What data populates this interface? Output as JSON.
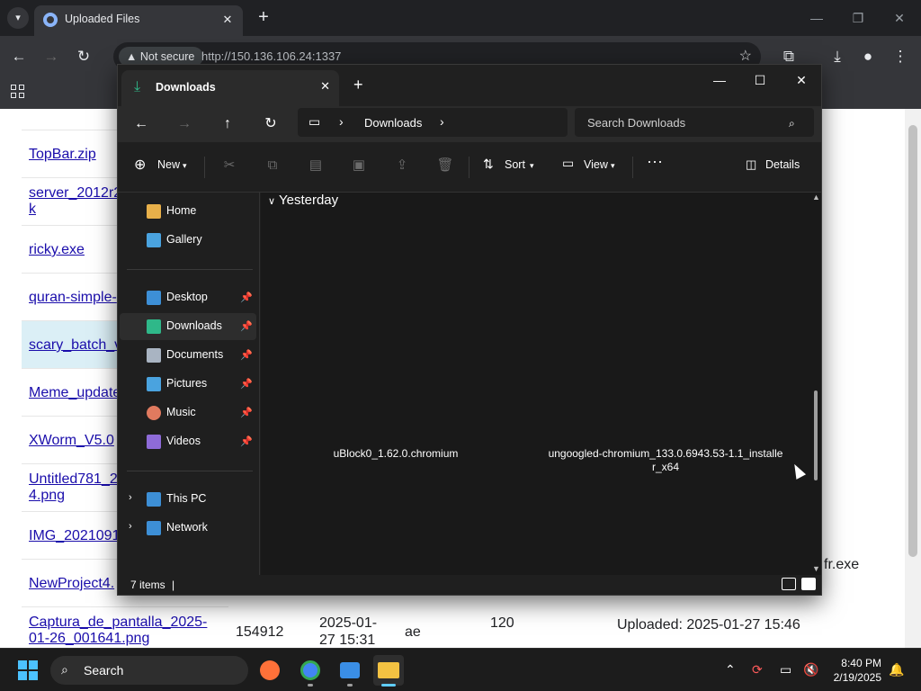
{
  "browser": {
    "tab_title": "Uploaded Files",
    "not_secure_label": "Not secure",
    "url": "http://150.136.106.24:1337"
  },
  "webpage": {
    "links": [
      {
        "text": "TopBar.zip"
      },
      {
        "text": "server_2012r2"
      },
      {
        "text": "k"
      },
      {
        "text": "ricky.exe"
      },
      {
        "text": "quran-simple-"
      },
      {
        "text": "scary_batch_v"
      },
      {
        "text": "Meme_update"
      },
      {
        "text": "XWorm_V5.0"
      },
      {
        "text": "Untitled781_2"
      },
      {
        "text": "4.png"
      },
      {
        "text": "IMG_2021091"
      },
      {
        "text": "NewProject4."
      },
      {
        "text": "Captura_de_pantalla_2025-"
      },
      {
        "text": "01-26_001641.png"
      }
    ],
    "last_row": {
      "size": "154912",
      "date_line1": "2025-01-",
      "date_line2": "27 15:31",
      "uploader": "ae",
      "count": "120"
    },
    "right_panel": {
      "filename_tail": "fr.exe",
      "uploaded": "Uploaded: 2025-01-27 15:46"
    }
  },
  "explorer": {
    "tab_title": "Downloads",
    "path": "Downloads",
    "search_placeholder": "Search Downloads",
    "commands": {
      "new": "New",
      "sort": "Sort",
      "view": "View",
      "details": "Details"
    },
    "nav": [
      {
        "label": "Home",
        "icon": "home-icon",
        "color": "#e8b04a"
      },
      {
        "label": "Gallery",
        "icon": "gallery-icon",
        "color": "#4aa3df"
      },
      {
        "label": "Desktop",
        "icon": "desktop-icon",
        "color": "#3d8fd6",
        "pinned": true
      },
      {
        "label": "Downloads",
        "icon": "download-icon",
        "color": "#2fb889",
        "pinned": true,
        "selected": true
      },
      {
        "label": "Documents",
        "icon": "document-icon",
        "color": "#a9b4c2",
        "pinned": true
      },
      {
        "label": "Pictures",
        "icon": "pictures-icon",
        "color": "#4aa3df",
        "pinned": true
      },
      {
        "label": "Music",
        "icon": "music-icon",
        "color": "#e07a5f",
        "pinned": true
      },
      {
        "label": "Videos",
        "icon": "videos-icon",
        "color": "#8e6bd8",
        "pinned": true
      },
      {
        "label": "This PC",
        "icon": "this-pc-icon",
        "color": "#3d8fd6"
      },
      {
        "label": "Network",
        "icon": "network-icon",
        "color": "#3d8fd6"
      }
    ],
    "group_header": "Yesterday",
    "files": [
      {
        "name": "uBlock0_1.62.0.chromium"
      },
      {
        "name_line1": "ungoogled-chromium_133.0.6943.53-1.1_installe",
        "name_line2": "r_x64"
      }
    ],
    "status": "7 items"
  },
  "taskbar": {
    "search_label": "Search",
    "time": "8:40 PM",
    "date": "2/19/2025"
  },
  "colors": {
    "chrome_dark": "#202124",
    "explorer_bg": "#191919",
    "link": "#1a0dab",
    "accent": "#4cc2ff"
  }
}
